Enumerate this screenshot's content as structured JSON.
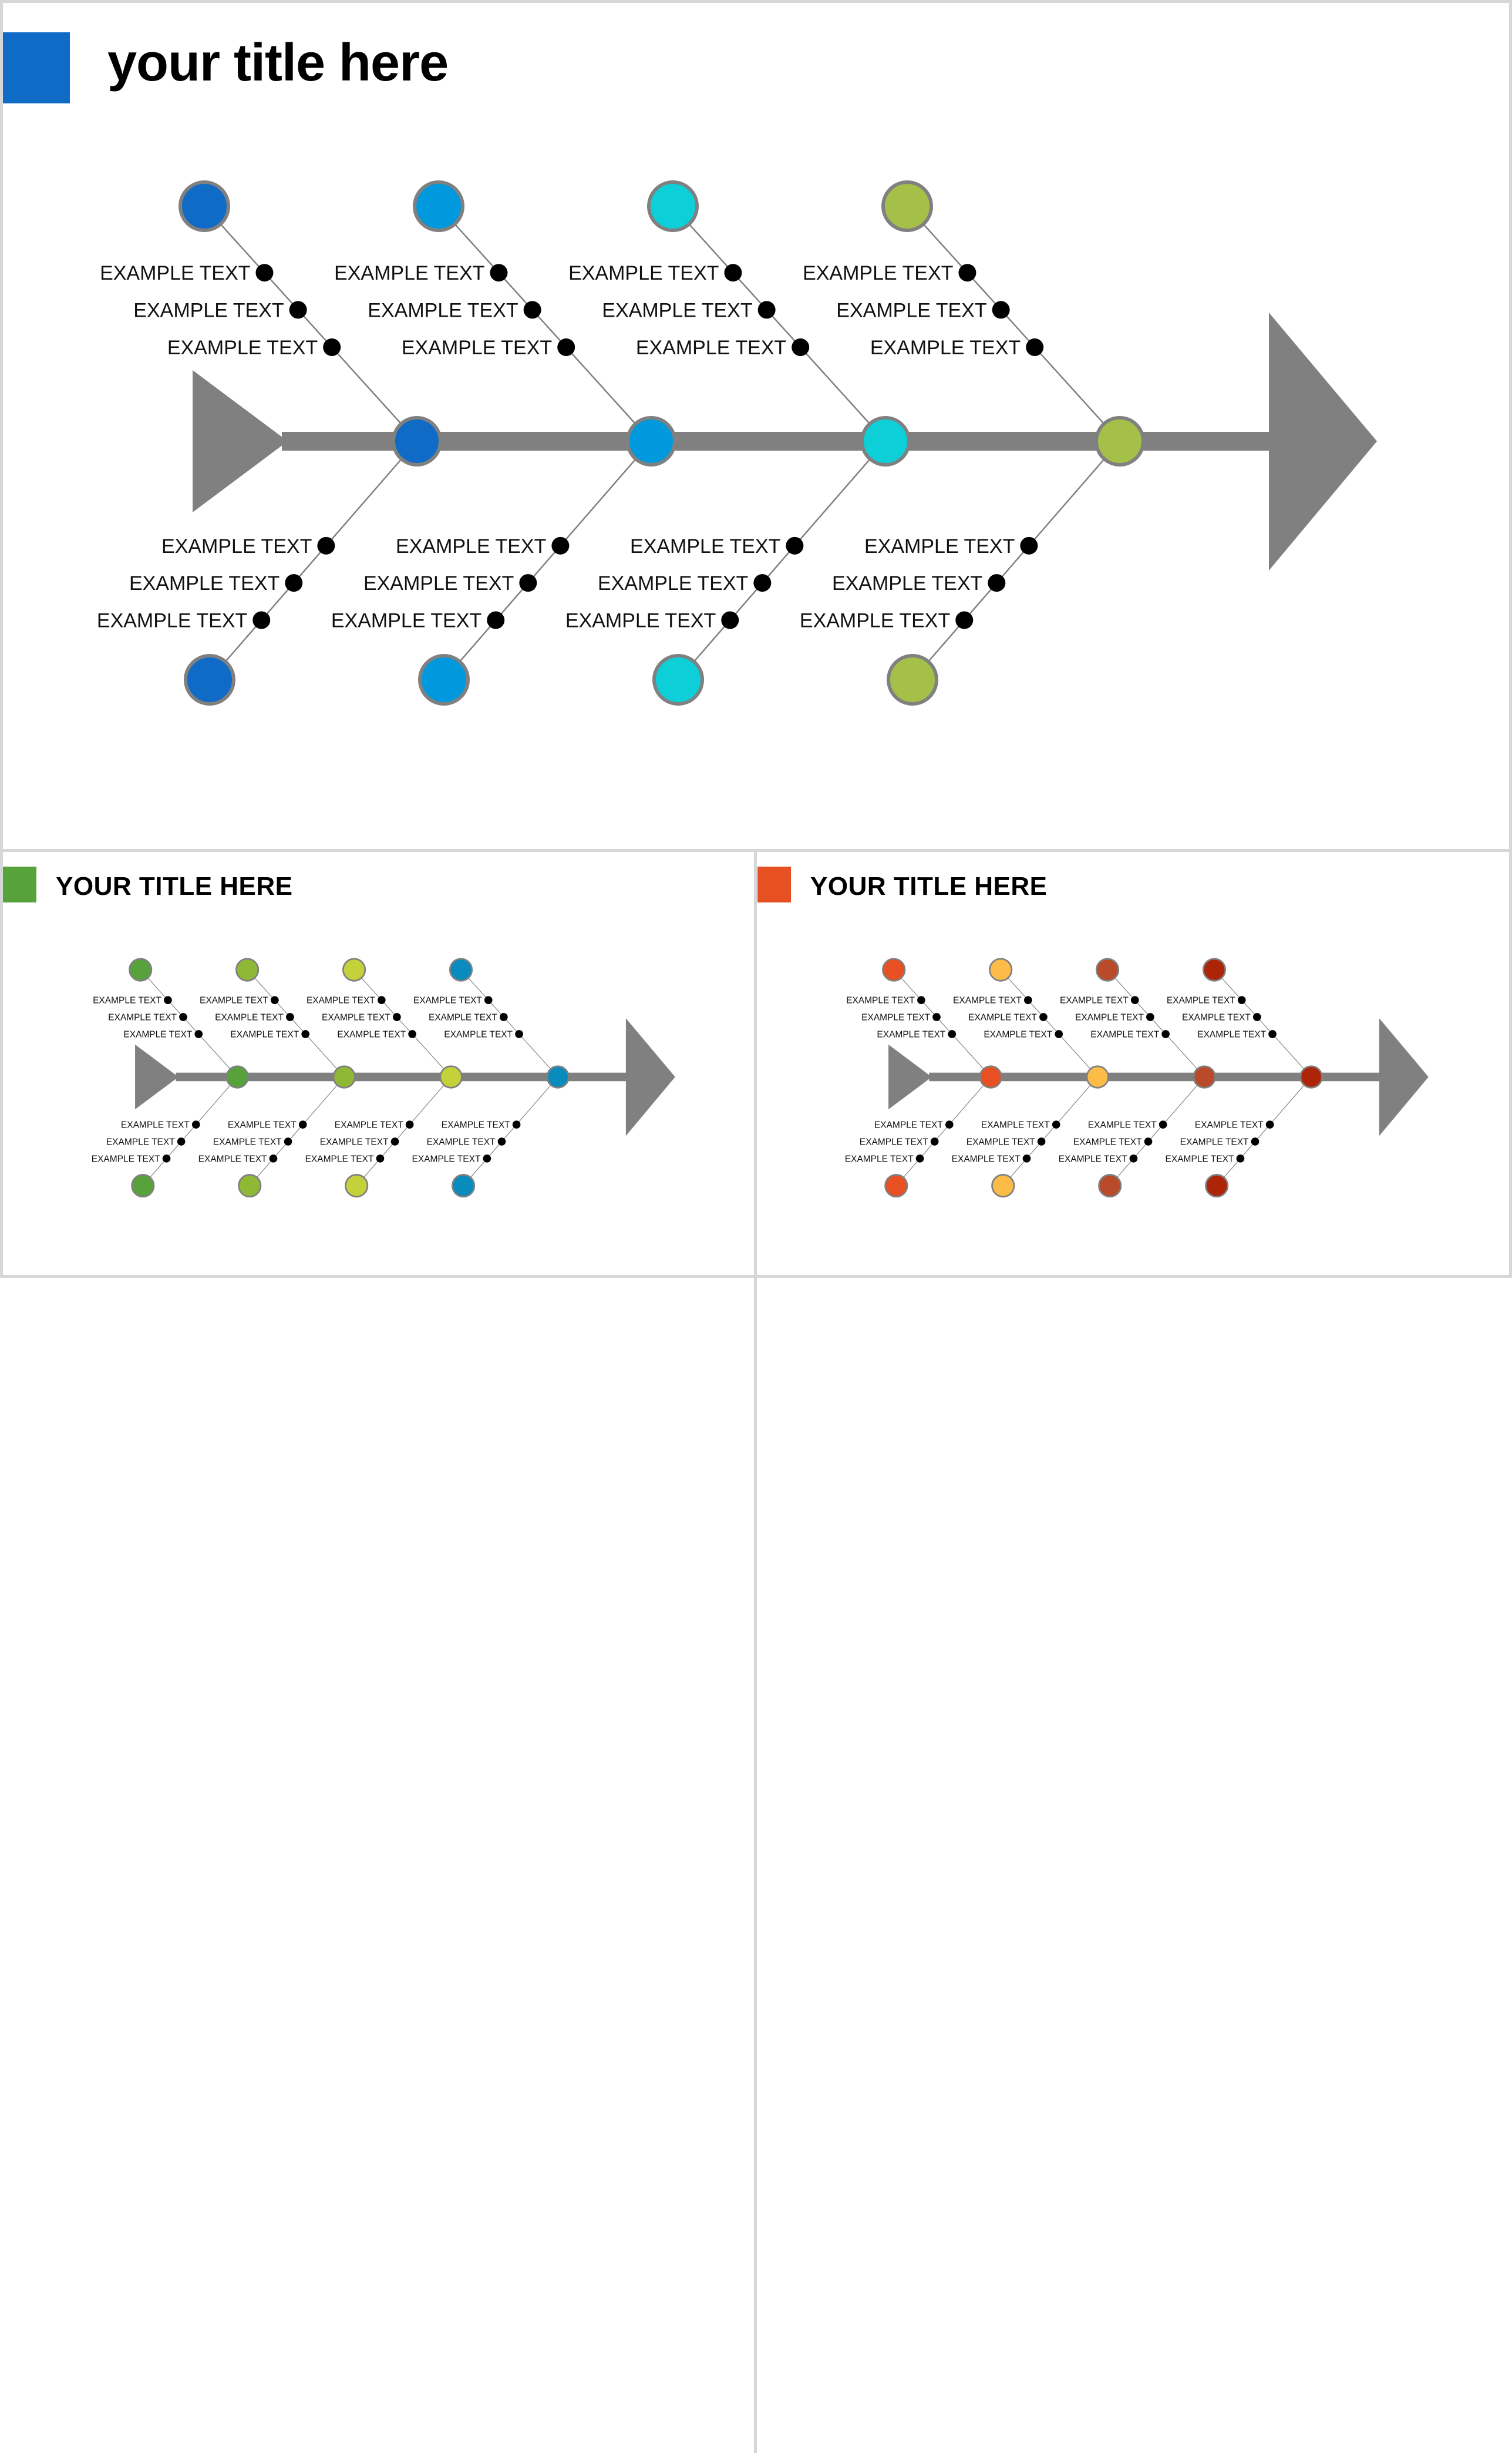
{
  "main_slide": {
    "title": "your title here",
    "accent_color": "#0f6bc6",
    "diagram": {
      "spine_color": "#808080",
      "dot_color": "#000000",
      "branch_colors": [
        "#0f6bc6",
        "#0099dd",
        "#0ccfd8",
        "#a4c049"
      ],
      "branches": [
        {
          "top_labels": [
            "EXAMPLE TEXT",
            "EXAMPLE TEXT",
            "EXAMPLE TEXT"
          ],
          "bottom_labels": [
            "EXAMPLE TEXT",
            "EXAMPLE TEXT",
            "EXAMPLE TEXT"
          ]
        },
        {
          "top_labels": [
            "EXAMPLE TEXT",
            "EXAMPLE TEXT",
            "EXAMPLE TEXT"
          ],
          "bottom_labels": [
            "EXAMPLE TEXT",
            "EXAMPLE TEXT",
            "EXAMPLE TEXT"
          ]
        },
        {
          "top_labels": [
            "EXAMPLE TEXT",
            "EXAMPLE TEXT",
            "EXAMPLE TEXT"
          ],
          "bottom_labels": [
            "EXAMPLE TEXT",
            "EXAMPLE TEXT",
            "EXAMPLE TEXT"
          ]
        },
        {
          "top_labels": [
            "EXAMPLE TEXT",
            "EXAMPLE TEXT",
            "EXAMPLE TEXT"
          ],
          "bottom_labels": [
            "EXAMPLE TEXT",
            "EXAMPLE TEXT",
            "EXAMPLE TEXT"
          ]
        }
      ]
    }
  },
  "green_slide": {
    "title": "YOUR TITLE HERE",
    "accent_color": "#58a23c",
    "diagram": {
      "spine_color": "#808080",
      "dot_color": "#000000",
      "branch_colors": [
        "#58a23c",
        "#8fb935",
        "#c4d13b",
        "#0a8bbd"
      ],
      "branches": [
        {
          "top_labels": [
            "EXAMPLE TEXT",
            "EXAMPLE TEXT",
            "EXAMPLE TEXT"
          ],
          "bottom_labels": [
            "EXAMPLE TEXT",
            "EXAMPLE TEXT",
            "EXAMPLE TEXT"
          ]
        },
        {
          "top_labels": [
            "EXAMPLE TEXT",
            "EXAMPLE TEXT",
            "EXAMPLE TEXT"
          ],
          "bottom_labels": [
            "EXAMPLE TEXT",
            "EXAMPLE TEXT",
            "EXAMPLE TEXT"
          ]
        },
        {
          "top_labels": [
            "EXAMPLE TEXT",
            "EXAMPLE TEXT",
            "EXAMPLE TEXT"
          ],
          "bottom_labels": [
            "EXAMPLE TEXT",
            "EXAMPLE TEXT",
            "EXAMPLE TEXT"
          ]
        },
        {
          "top_labels": [
            "EXAMPLE TEXT",
            "EXAMPLE TEXT",
            "EXAMPLE TEXT"
          ],
          "bottom_labels": [
            "EXAMPLE TEXT",
            "EXAMPLE TEXT",
            "EXAMPLE TEXT"
          ]
        }
      ]
    }
  },
  "orange_slide": {
    "title": "YOUR TITLE HERE",
    "accent_color": "#e65022",
    "diagram": {
      "spine_color": "#808080",
      "dot_color": "#000000",
      "branch_colors": [
        "#e65022",
        "#fdbb48",
        "#b94a2a",
        "#ad2508"
      ],
      "branches": [
        {
          "top_labels": [
            "EXAMPLE TEXT",
            "EXAMPLE TEXT",
            "EXAMPLE TEXT"
          ],
          "bottom_labels": [
            "EXAMPLE TEXT",
            "EXAMPLE TEXT",
            "EXAMPLE TEXT"
          ]
        },
        {
          "top_labels": [
            "EXAMPLE TEXT",
            "EXAMPLE TEXT",
            "EXAMPLE TEXT"
          ],
          "bottom_labels": [
            "EXAMPLE TEXT",
            "EXAMPLE TEXT",
            "EXAMPLE TEXT"
          ]
        },
        {
          "top_labels": [
            "EXAMPLE TEXT",
            "EXAMPLE TEXT",
            "EXAMPLE TEXT"
          ],
          "bottom_labels": [
            "EXAMPLE TEXT",
            "EXAMPLE TEXT",
            "EXAMPLE TEXT"
          ]
        },
        {
          "top_labels": [
            "EXAMPLE TEXT",
            "EXAMPLE TEXT",
            "EXAMPLE TEXT"
          ],
          "bottom_labels": [
            "EXAMPLE TEXT",
            "EXAMPLE TEXT",
            "EXAMPLE TEXT"
          ]
        }
      ]
    }
  }
}
